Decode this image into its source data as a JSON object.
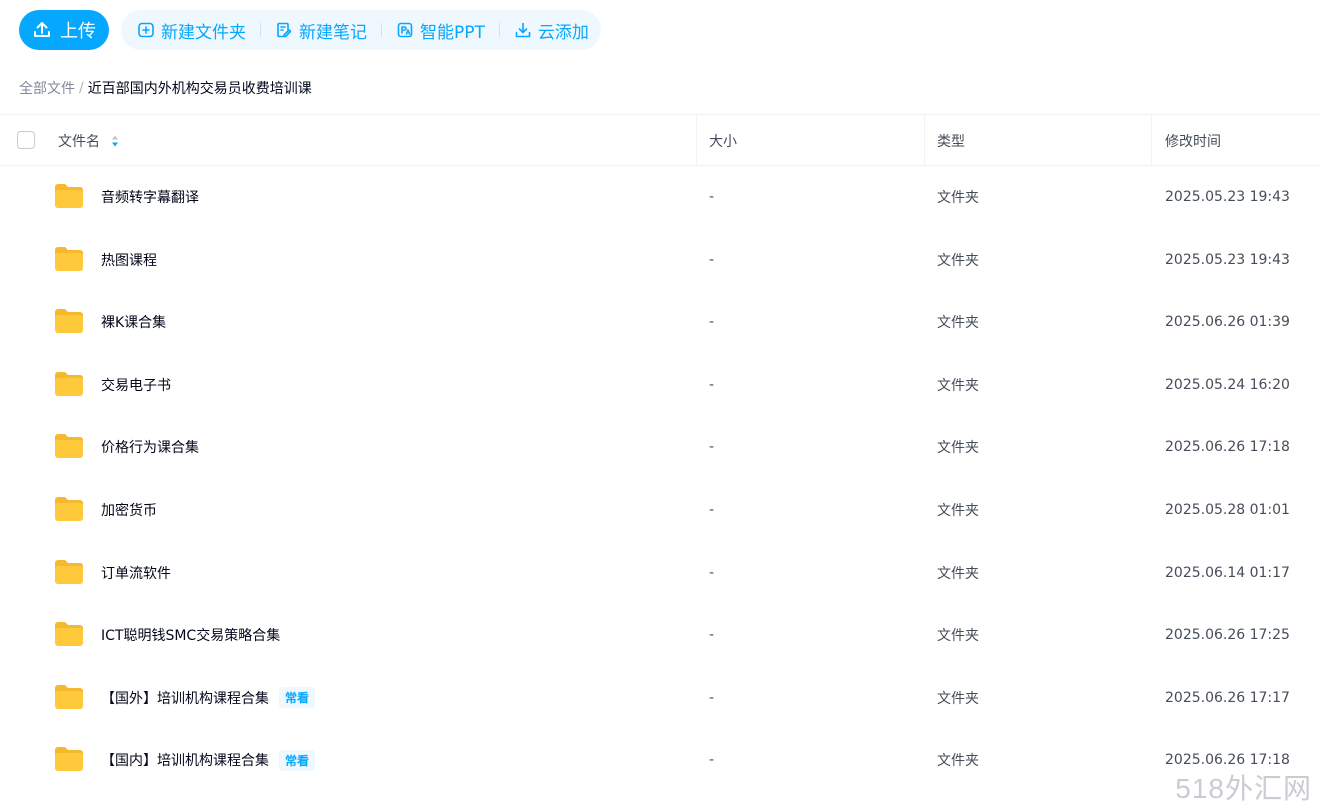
{
  "toolbar": {
    "upload_label": "上传",
    "actions": [
      {
        "label": "新建文件夹",
        "icon": "new-folder-icon"
      },
      {
        "label": "新建笔记",
        "icon": "new-note-icon"
      },
      {
        "label": "智能PPT",
        "icon": "smart-ppt-icon"
      },
      {
        "label": "云添加",
        "icon": "cloud-add-icon"
      }
    ]
  },
  "breadcrumb": {
    "root": "全部文件",
    "separator": "/",
    "current": "近百部国内外机构交易员收费培训课"
  },
  "table": {
    "headers": {
      "name": "文件名",
      "size": "大小",
      "type": "类型",
      "modified": "修改时间"
    },
    "rows": [
      {
        "name": "音频转字幕翻译",
        "badge": "",
        "size": "-",
        "type": "文件夹",
        "modified": "2025.05.23 19:43"
      },
      {
        "name": "热图课程",
        "badge": "",
        "size": "-",
        "type": "文件夹",
        "modified": "2025.05.23 19:43"
      },
      {
        "name": "裸K课合集",
        "badge": "",
        "size": "-",
        "type": "文件夹",
        "modified": "2025.06.26 01:39"
      },
      {
        "name": "交易电子书",
        "badge": "",
        "size": "-",
        "type": "文件夹",
        "modified": "2025.05.24 16:20"
      },
      {
        "name": "价格行为课合集",
        "badge": "",
        "size": "-",
        "type": "文件夹",
        "modified": "2025.06.26 17:18"
      },
      {
        "name": "加密货币",
        "badge": "",
        "size": "-",
        "type": "文件夹",
        "modified": "2025.05.28 01:01"
      },
      {
        "name": "订单流软件",
        "badge": "",
        "size": "-",
        "type": "文件夹",
        "modified": "2025.06.14 01:17"
      },
      {
        "name": "ICT聪明钱SMC交易策略合集",
        "badge": "",
        "size": "-",
        "type": "文件夹",
        "modified": "2025.06.26 17:25"
      },
      {
        "name": "【国外】培训机构课程合集",
        "badge": "常看",
        "size": "-",
        "type": "文件夹",
        "modified": "2025.06.26 17:17"
      },
      {
        "name": "【国内】培训机构课程合集",
        "badge": "常看",
        "size": "-",
        "type": "文件夹",
        "modified": "2025.06.26 17:18"
      }
    ]
  },
  "watermark": "518外汇网",
  "colors": {
    "accent": "#06a7ff",
    "accent_bg": "#eef8fe",
    "folder": "#ffc93c"
  }
}
